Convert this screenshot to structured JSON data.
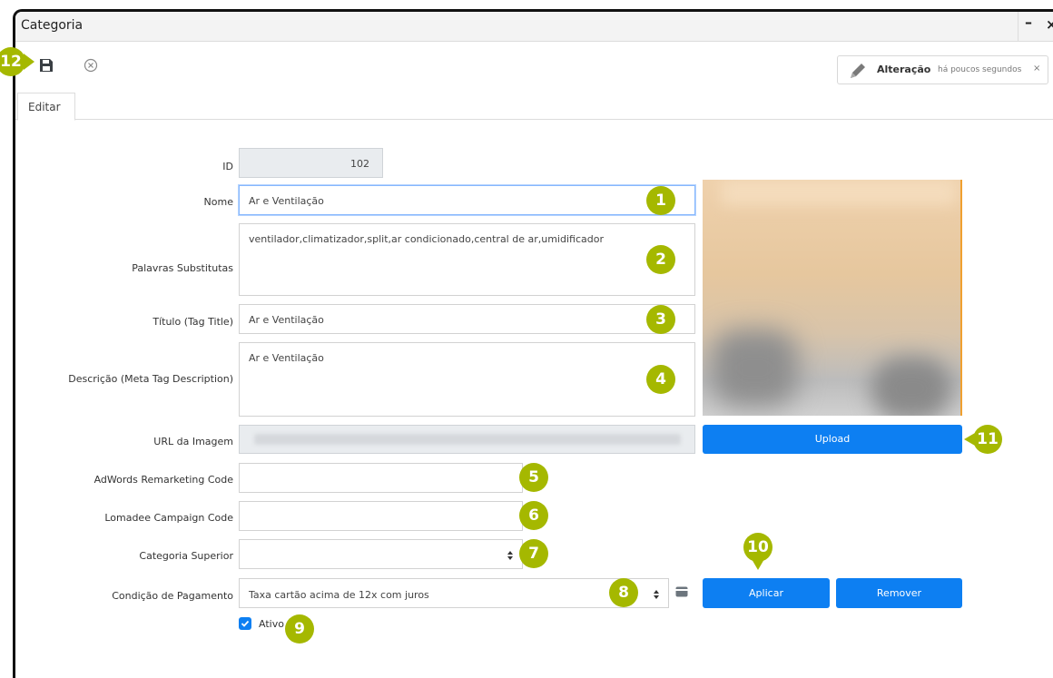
{
  "window": {
    "title": "Categoria",
    "minimize": "–",
    "close": "×"
  },
  "toolbar": {
    "save_icon": "save-icon",
    "cancel_icon": "cancel-circle-icon"
  },
  "change_badge": {
    "label": "Alteração",
    "time": "há poucos segundos",
    "close": "×"
  },
  "tabs": [
    {
      "label": "Editar"
    }
  ],
  "form": {
    "id": {
      "label": "ID",
      "value": "102"
    },
    "nome": {
      "label": "Nome",
      "value": "Ar e Ventilação"
    },
    "palavras": {
      "label": "Palavras Substitutas",
      "value": "ventilador,climatizador,split,ar condicionado,central de ar,umidificador"
    },
    "titulo": {
      "label": "Título (Tag Title)",
      "value": "Ar e Ventilação"
    },
    "descricao": {
      "label": "Descrição (Meta Tag Description)",
      "value": "Ar e Ventilação"
    },
    "url_imagem": {
      "label": "URL da Imagem",
      "value": ""
    },
    "adwords": {
      "label": "AdWords Remarketing Code",
      "value": ""
    },
    "lomadee": {
      "label": "Lomadee Campaign Code",
      "value": ""
    },
    "categoria_superior": {
      "label": "Categoria Superior",
      "value": ""
    },
    "condicao": {
      "label": "Condição de Pagamento",
      "value": "Taxa cartão acima de 12x com juros"
    },
    "ativo": {
      "label": "Ativo",
      "checked": true
    }
  },
  "buttons": {
    "upload": "Upload",
    "aplicar": "Aplicar",
    "remover": "Remover"
  },
  "markers": [
    "1",
    "2",
    "3",
    "4",
    "5",
    "6",
    "7",
    "8",
    "9",
    "10",
    "11",
    "12"
  ],
  "colors": {
    "primary": "#0d7ff2",
    "marker": "#a5b800"
  }
}
